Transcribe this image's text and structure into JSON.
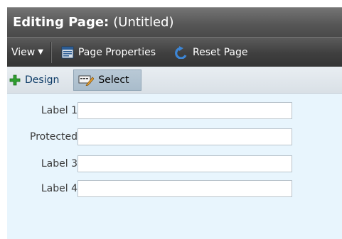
{
  "header": {
    "title_label": "Editing Page:",
    "page_name": "(Untitled)"
  },
  "toolbar": {
    "view_label": "View",
    "page_properties_label": "Page Properties",
    "reset_page_label": "Reset Page"
  },
  "mode_bar": {
    "design_label": "Design",
    "select_label": "Select"
  },
  "form": {
    "fields": [
      {
        "label": "Label 1",
        "value": ""
      },
      {
        "label": "Protected",
        "value": ""
      },
      {
        "label": "Label 3",
        "value": ""
      },
      {
        "label": "Label 4",
        "value": ""
      }
    ]
  },
  "icons": {
    "view_caret": "chevron-down-icon",
    "page_properties": "page-properties-icon",
    "reset_page": "reset-undo-icon",
    "design": "plus-icon",
    "select": "select-pencil-icon"
  },
  "colors": {
    "title_bar": "#555555",
    "toolbar": "#3f3f3f",
    "mode_bar": "#dfe6ec",
    "form_bg": "#e8f5fd",
    "design_plus": "#2e9e2e",
    "reset_icon": "#3d86d6"
  }
}
